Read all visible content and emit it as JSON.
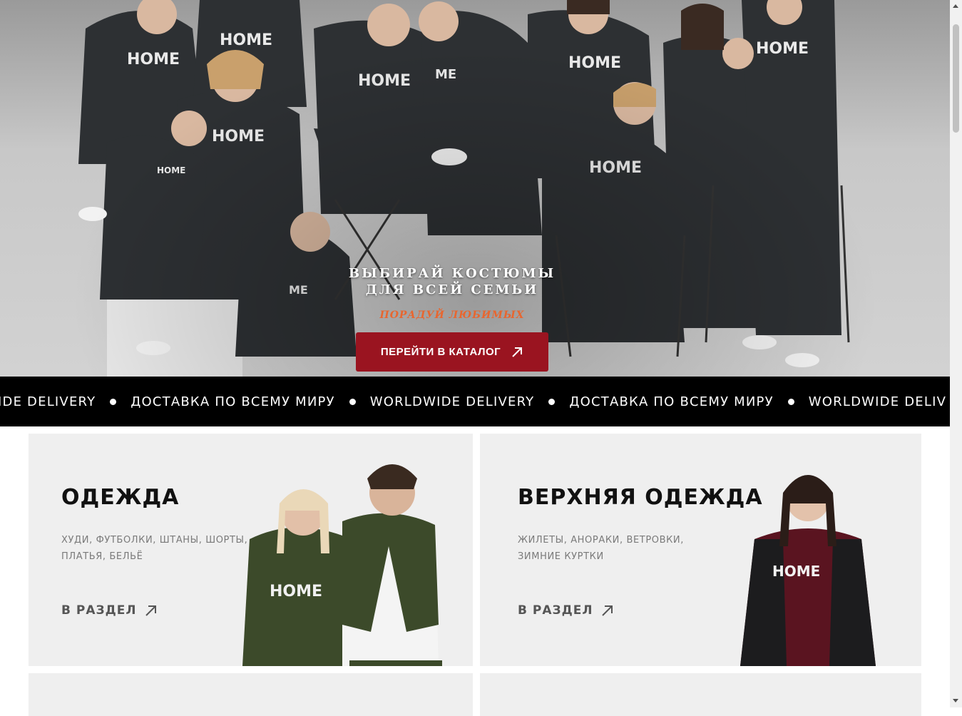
{
  "hero": {
    "title_line1": "ВЫБИРАЙ КОСТЮМЫ",
    "title_line2": "ДЛЯ ВСЕЙ СЕМЬИ",
    "subtitle": "ПОРАДУЙ ЛЮБИМЫХ",
    "cta_label": "ПЕРЕЙТИ В КАТАЛОГ",
    "shirt_print": "HOME"
  },
  "marquee": {
    "items": [
      "WIDE DELIVERY",
      "ДОСТАВКА ПО ВСЕМУ МИРУ",
      "WORLDWIDE DELIVERY",
      "ДОСТАВКА ПО ВСЕМУ МИРУ",
      "WORLDWIDE DELIV"
    ]
  },
  "categories": [
    {
      "title": "ОДЕЖДА",
      "desc_line1": "ХУДИ, ФУТБОЛКИ, ШТАНЫ, ШОРТЫ,",
      "desc_line2": "ПЛАТЬЯ, БЕЛЬЁ",
      "link_label": "В РАЗДЕЛ"
    },
    {
      "title": "ВЕРХНЯЯ ОДЕЖДА",
      "desc_line1": "ЖИЛЕТЫ, АНОРАКИ, ВЕТРОВКИ,",
      "desc_line2": "ЗИМНИЕ КУРТКИ",
      "link_label": "В РАЗДЕЛ"
    }
  ],
  "colors": {
    "accent": "#9a1420",
    "subtitle": "#e8662f",
    "marquee_bg": "#000000",
    "card_bg": "#efefef"
  }
}
